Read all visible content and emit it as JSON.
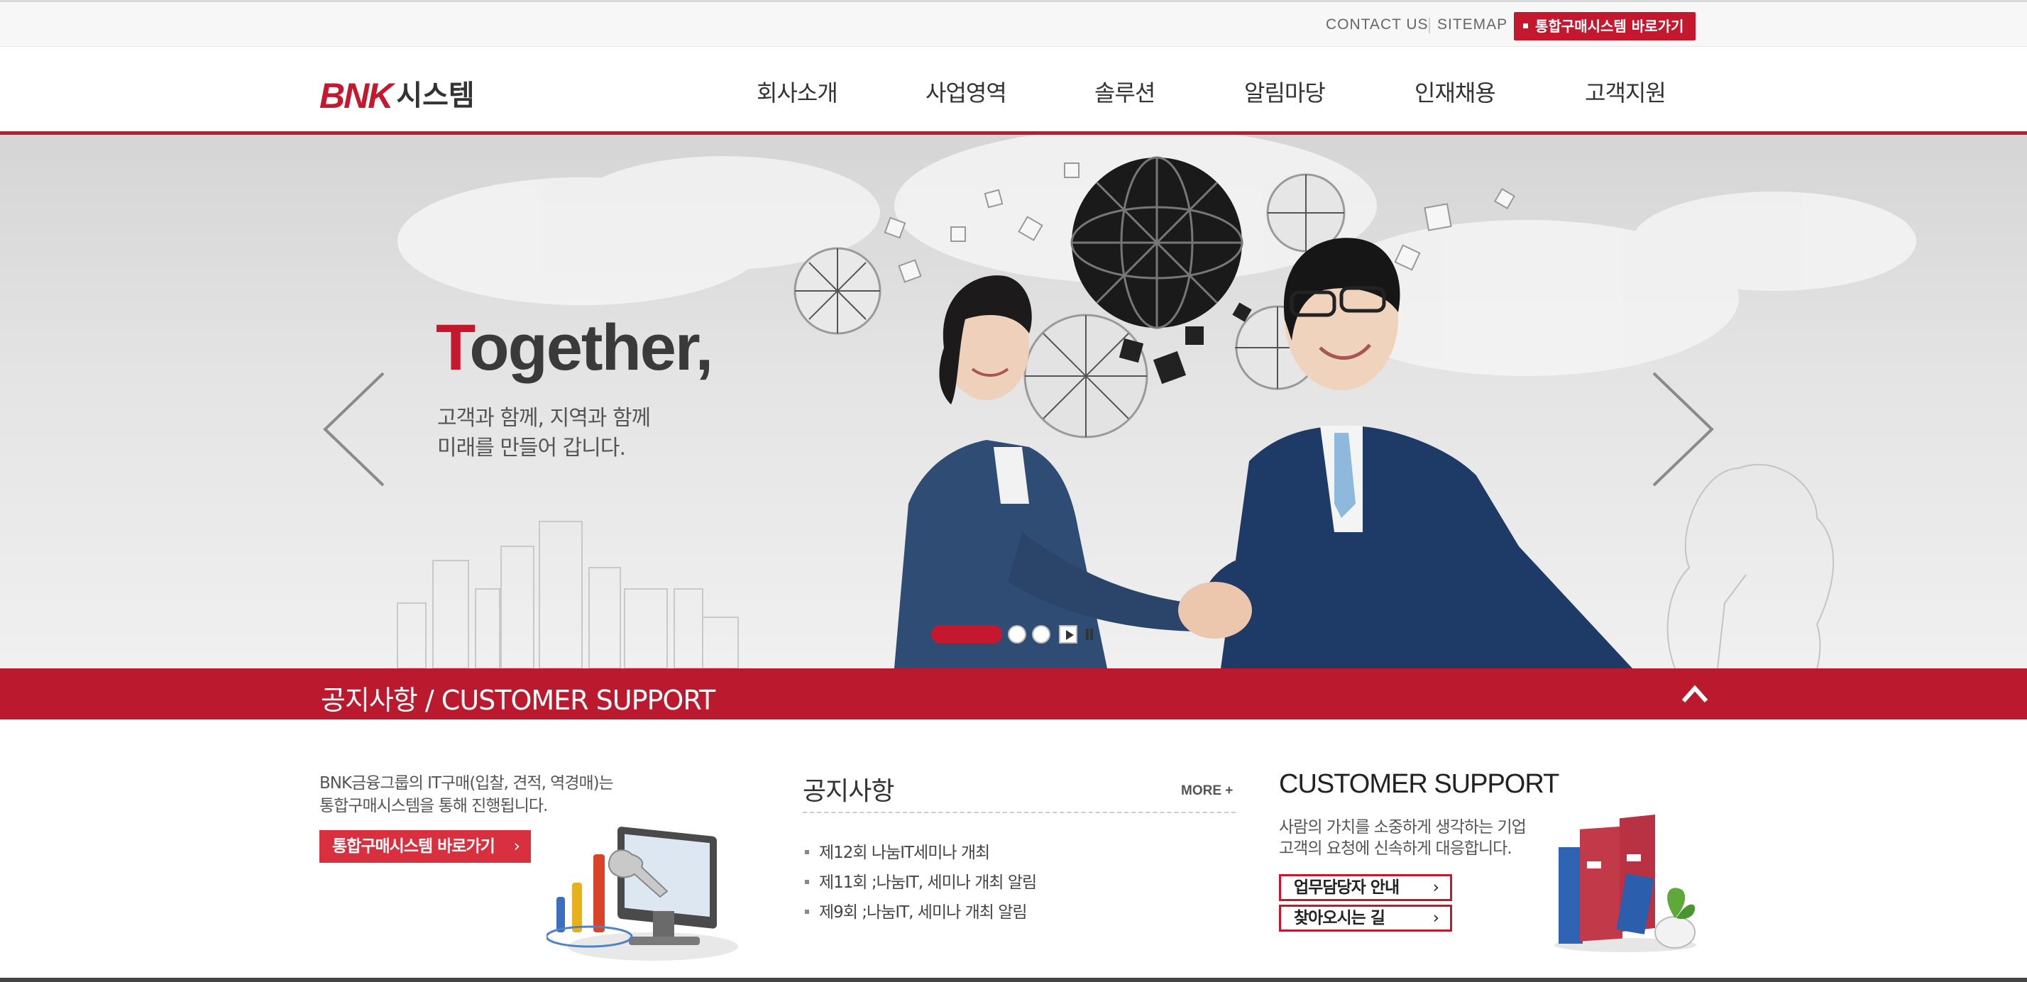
{
  "topbar": {
    "contact_label": "CONTACT US",
    "sitemap_label": "SITEMAP",
    "portal_button": "통합구매시스템 바로가기"
  },
  "header": {
    "logo_en": "BNK",
    "logo_ko": "시스템",
    "nav": [
      "회사소개",
      "사업영역",
      "솔루션",
      "알림마당",
      "인재채용",
      "고객지원"
    ]
  },
  "hero": {
    "title_first_letter": "T",
    "title_rest": "ogether,",
    "subtitle_line1": "고객과 함께, 지역과 함께",
    "subtitle_line2": "미래를 만들어 갑니다."
  },
  "band": {
    "title": "공지사항 / CUSTOMER SUPPORT"
  },
  "purchase_block": {
    "line1": "BNK금융그룹의 IT구매(입찰, 견적, 역경매)는",
    "line2": "통합구매시스템을 통해 진행됩니다.",
    "button": "통합구매시스템 바로가기"
  },
  "notice_block": {
    "title": "공지사항",
    "more": "MORE +",
    "items": [
      "제12회 나눔IT세미나 개최",
      "제11회 ;나눔IT, 세미나 개최 알림",
      "제9회 ;나눔IT, 세미나 개최 알림"
    ]
  },
  "support_block": {
    "title": "CUSTOMER SUPPORT",
    "line1": "사람의 가치를 소중하게 생각하는 기업",
    "line2": "고객의 요청에 신속하게 대응합니다.",
    "button1": "업무담당자 안내",
    "button2": "찾아오시는 길"
  },
  "colors": {
    "brand_red": "#c3182d",
    "band_red": "#bb1a2e"
  },
  "icons": [
    "arrow-left-icon",
    "arrow-right-icon",
    "chevron-up-icon",
    "play-icon",
    "pause-icon",
    "chevron-right-icon"
  ]
}
